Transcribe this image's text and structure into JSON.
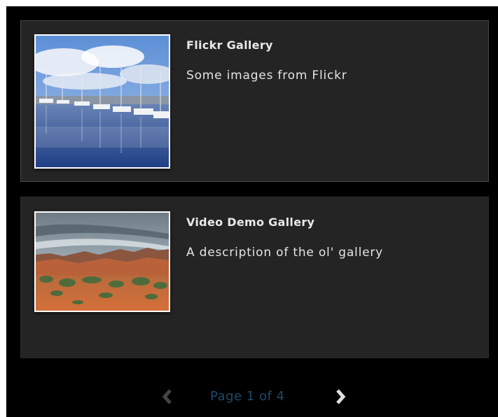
{
  "galleries": [
    {
      "title": "Flickr Gallery",
      "description": "Some images from Flickr",
      "thumbnail": "harbor-sailboats-image"
    },
    {
      "title": "Video Demo Gallery",
      "description": "A description of the ol' gallery",
      "thumbnail": "desert-landscape-image"
    }
  ],
  "pagination": {
    "label": "Page 1 of 4",
    "prev_icon": "chevron-left-icon",
    "next_icon": "chevron-right-icon",
    "current_page": 1,
    "total_pages": 4
  },
  "colors": {
    "background": "#000000",
    "card": "#242424",
    "text": "#e8e8e8",
    "pager_label": "#1e4a6a",
    "prev_disabled": "#444444",
    "next_enabled": "#dddddd"
  }
}
